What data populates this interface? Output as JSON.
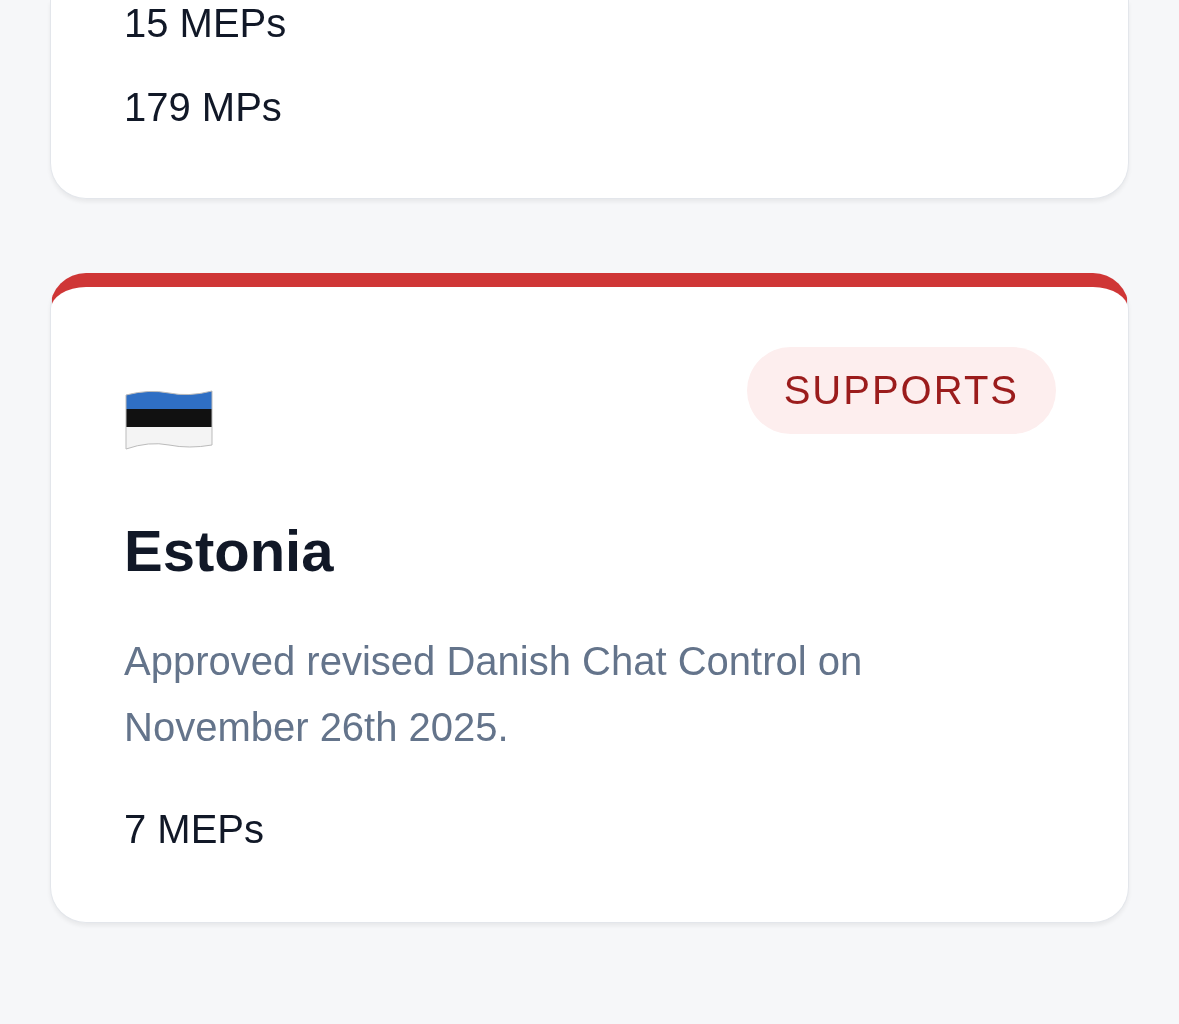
{
  "previous_card": {
    "stats": [
      "15 MEPs",
      "179 MPs"
    ]
  },
  "country_card": {
    "stance": {
      "kind": "supports",
      "label": "SUPPORTS"
    },
    "country": "Estonia",
    "description": "Approved revised Danish Chat Control on November 26th 2025.",
    "stats": [
      "7 MEPs"
    ]
  }
}
